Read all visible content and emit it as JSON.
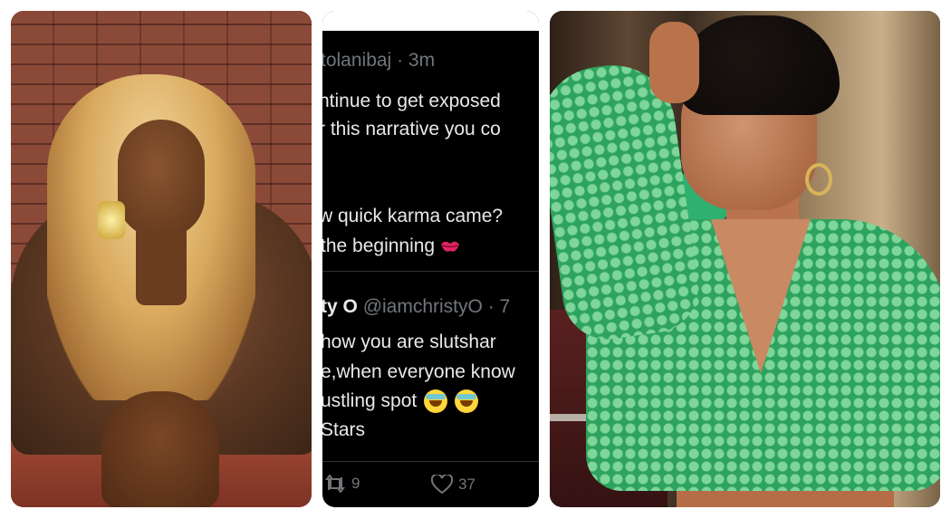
{
  "tweet": {
    "top_handle": "tolanibaj",
    "top_time": "3m",
    "line1": "ntinue to get exposed",
    "line2": "r this narrative you co",
    "line3": "w quick karma came?",
    "line4": "the beginning",
    "reply_name": "ty O",
    "reply_handle": "@iamchristyO",
    "reply_time": "7",
    "reply_line1": "how you are slutshar",
    "reply_line2": "e,when everyone know",
    "reply_line3": "ustling spot",
    "reply_line4": "Stars",
    "retweets": "9",
    "likes": "37"
  },
  "icons": [
    "kiss-mark-icon",
    "rolling-laughing-emoji-icon",
    "retweet-icon",
    "heart-icon"
  ],
  "colors": {
    "tweet_bg": "#000000",
    "tweet_text": "#e7e9ea",
    "tweet_muted": "#71767b",
    "top_green": "#2ea35f"
  }
}
